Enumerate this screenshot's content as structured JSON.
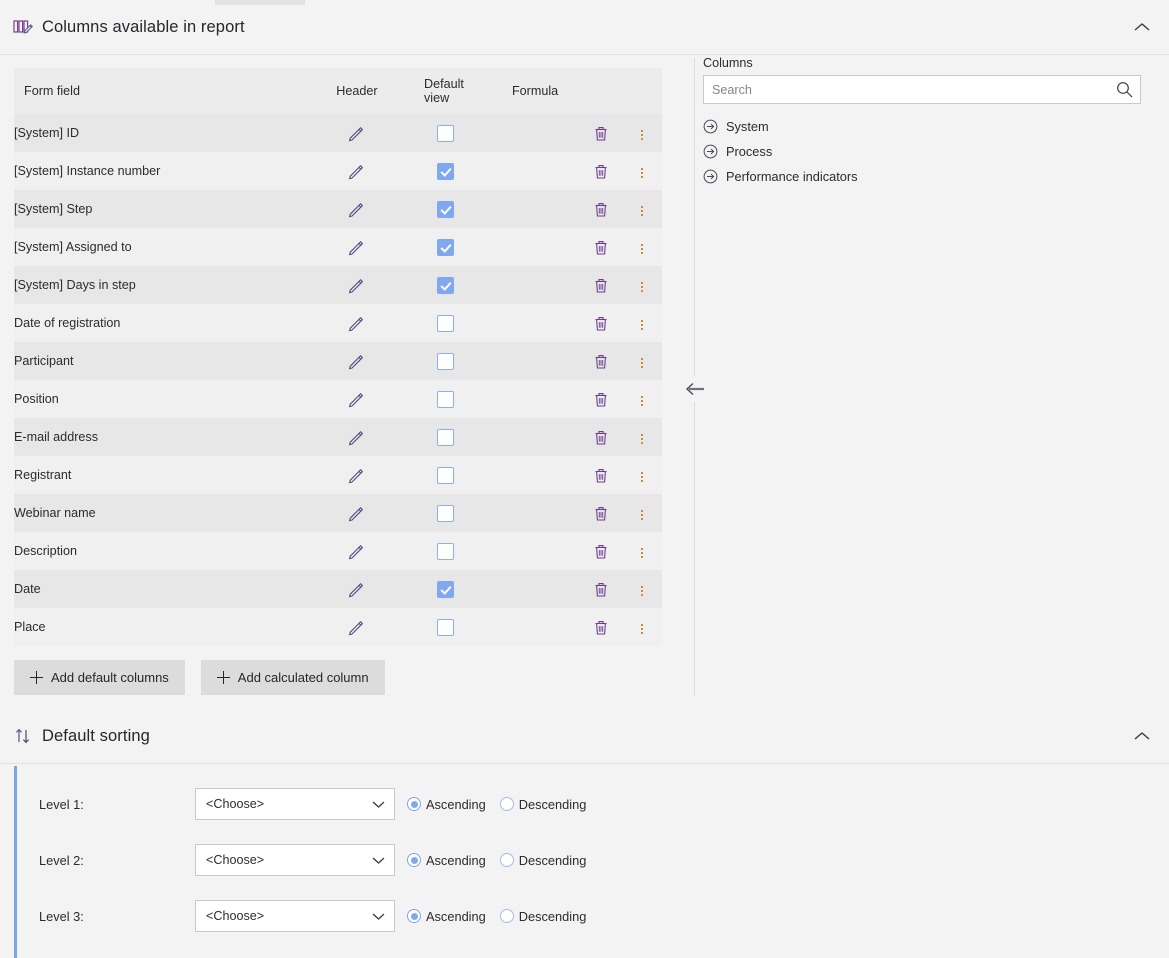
{
  "columns_section": {
    "title": "Columns available in report",
    "icon": "columns-edit-icon",
    "collapse_icon": "chevron-up-icon",
    "table": {
      "headers": {
        "form_field": "Form field",
        "header": "Header",
        "default_view_line1": "Default",
        "default_view_line2": "view",
        "formula": "Formula"
      },
      "rows": [
        {
          "field": "[System] ID",
          "default_view": false
        },
        {
          "field": "[System] Instance number",
          "default_view": true
        },
        {
          "field": "[System] Step",
          "default_view": true
        },
        {
          "field": "[System] Assigned to",
          "default_view": true
        },
        {
          "field": "[System] Days in step",
          "default_view": true
        },
        {
          "field": "Date of registration",
          "default_view": false
        },
        {
          "field": "Participant",
          "default_view": false
        },
        {
          "field": "Position",
          "default_view": false
        },
        {
          "field": "E-mail address",
          "default_view": false
        },
        {
          "field": "Registrant",
          "default_view": false
        },
        {
          "field": "Webinar name",
          "default_view": false
        },
        {
          "field": "Description",
          "default_view": false
        },
        {
          "field": "Date",
          "default_view": true
        },
        {
          "field": "Place",
          "default_view": false
        }
      ],
      "row_icons": {
        "edit": "pencil-icon",
        "delete": "trash-icon",
        "more": "more-vertical-icon"
      }
    },
    "buttons": {
      "add_default_columns": "Add default columns",
      "add_calculated_column": "Add calculated column"
    }
  },
  "columns_panel": {
    "label": "Columns",
    "search": {
      "placeholder": "Search",
      "value": "",
      "icon": "search-icon"
    },
    "categories": [
      {
        "label": "System",
        "icon": "arrow-right-circle-icon"
      },
      {
        "label": "Process",
        "icon": "arrow-right-circle-icon"
      },
      {
        "label": "Performance indicators",
        "icon": "arrow-right-circle-icon"
      }
    ],
    "collapse_panel_icon": "arrow-left-icon"
  },
  "sorting_section": {
    "title": "Default sorting",
    "icon": "sort-updown-icon",
    "collapse_icon": "chevron-up-icon",
    "levels": [
      {
        "label": "Level 1:",
        "select_value": "<Choose>",
        "ascending": "Ascending",
        "descending": "Descending",
        "selected": "ascending"
      },
      {
        "label": "Level 2:",
        "select_value": "<Choose>",
        "ascending": "Ascending",
        "descending": "Descending",
        "selected": "ascending"
      },
      {
        "label": "Level 3:",
        "select_value": "<Choose>",
        "ascending": "Ascending",
        "descending": "Descending",
        "selected": "ascending"
      }
    ],
    "accent_color": "#7ba7e0"
  },
  "theme": {
    "checkbox_checked": "#7fa8ef",
    "row_odd": "#e7e7e7",
    "row_even": "#f0f0f0",
    "page_bg": "#f3f3f4"
  }
}
